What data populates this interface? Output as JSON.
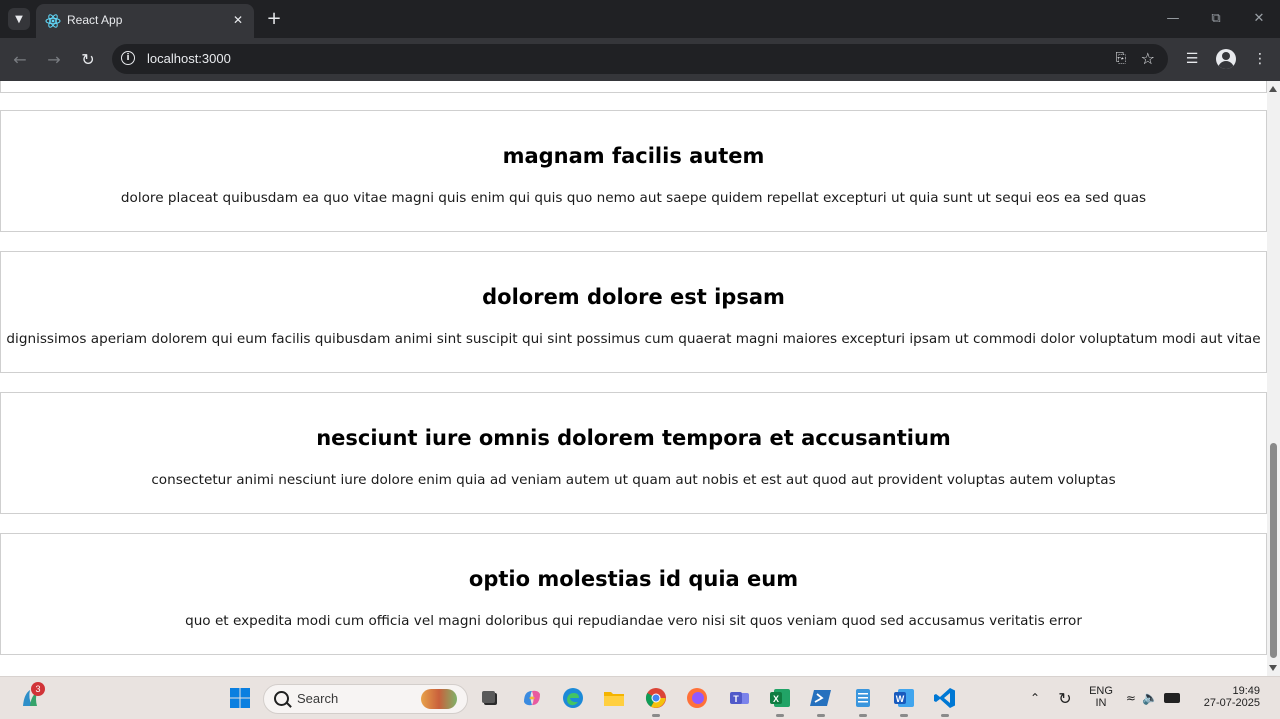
{
  "browser": {
    "tab_title": "React App",
    "url": "localhost:3000"
  },
  "posts": [
    {
      "title": "magnam facilis autem",
      "body": "dolore placeat quibusdam ea quo vitae magni quis enim qui quis quo nemo aut saepe quidem repellat excepturi ut quia sunt ut sequi eos ea sed quas"
    },
    {
      "title": "dolorem dolore est ipsam",
      "body": "dignissimos aperiam dolorem qui eum facilis quibusdam animi sint suscipit qui sint possimus cum quaerat magni maiores excepturi ipsam ut commodi dolor voluptatum modi aut vitae"
    },
    {
      "title": "nesciunt iure omnis dolorem tempora et accusantium",
      "body": "consectetur animi nesciunt iure dolore enim quia ad veniam autem ut quam aut nobis et est aut quod aut provident voluptas autem voluptas"
    },
    {
      "title": "optio molestias id quia eum",
      "body": "quo et expedita modi cum officia vel magni doloribus qui repudiandae vero nisi sit quos veniam quod sed accusamus veritatis error"
    }
  ],
  "taskbar": {
    "search_placeholder": "Search",
    "widget_badge": "3",
    "language_top": "ENG",
    "language_bottom": "IN",
    "time": "19:49",
    "date": "27-07-2025"
  },
  "icons": {
    "tab_list": "chevron-down-icon",
    "favicon": "react-icon",
    "close": "close-icon",
    "new_tab": "plus-icon",
    "back": "back-arrow-icon",
    "forward": "forward-arrow-icon",
    "reload": "reload-icon",
    "site_info": "info-icon",
    "install": "install-app-icon",
    "bookmark": "star-icon",
    "media": "media-controls-icon",
    "profile": "profile-icon",
    "menu": "kebab-menu-icon"
  },
  "colors": {
    "browser_frame": "#202124",
    "browser_toolbar": "#35363a",
    "card_border": "#cfcfcf",
    "taskbar": "#e9e3e0"
  }
}
